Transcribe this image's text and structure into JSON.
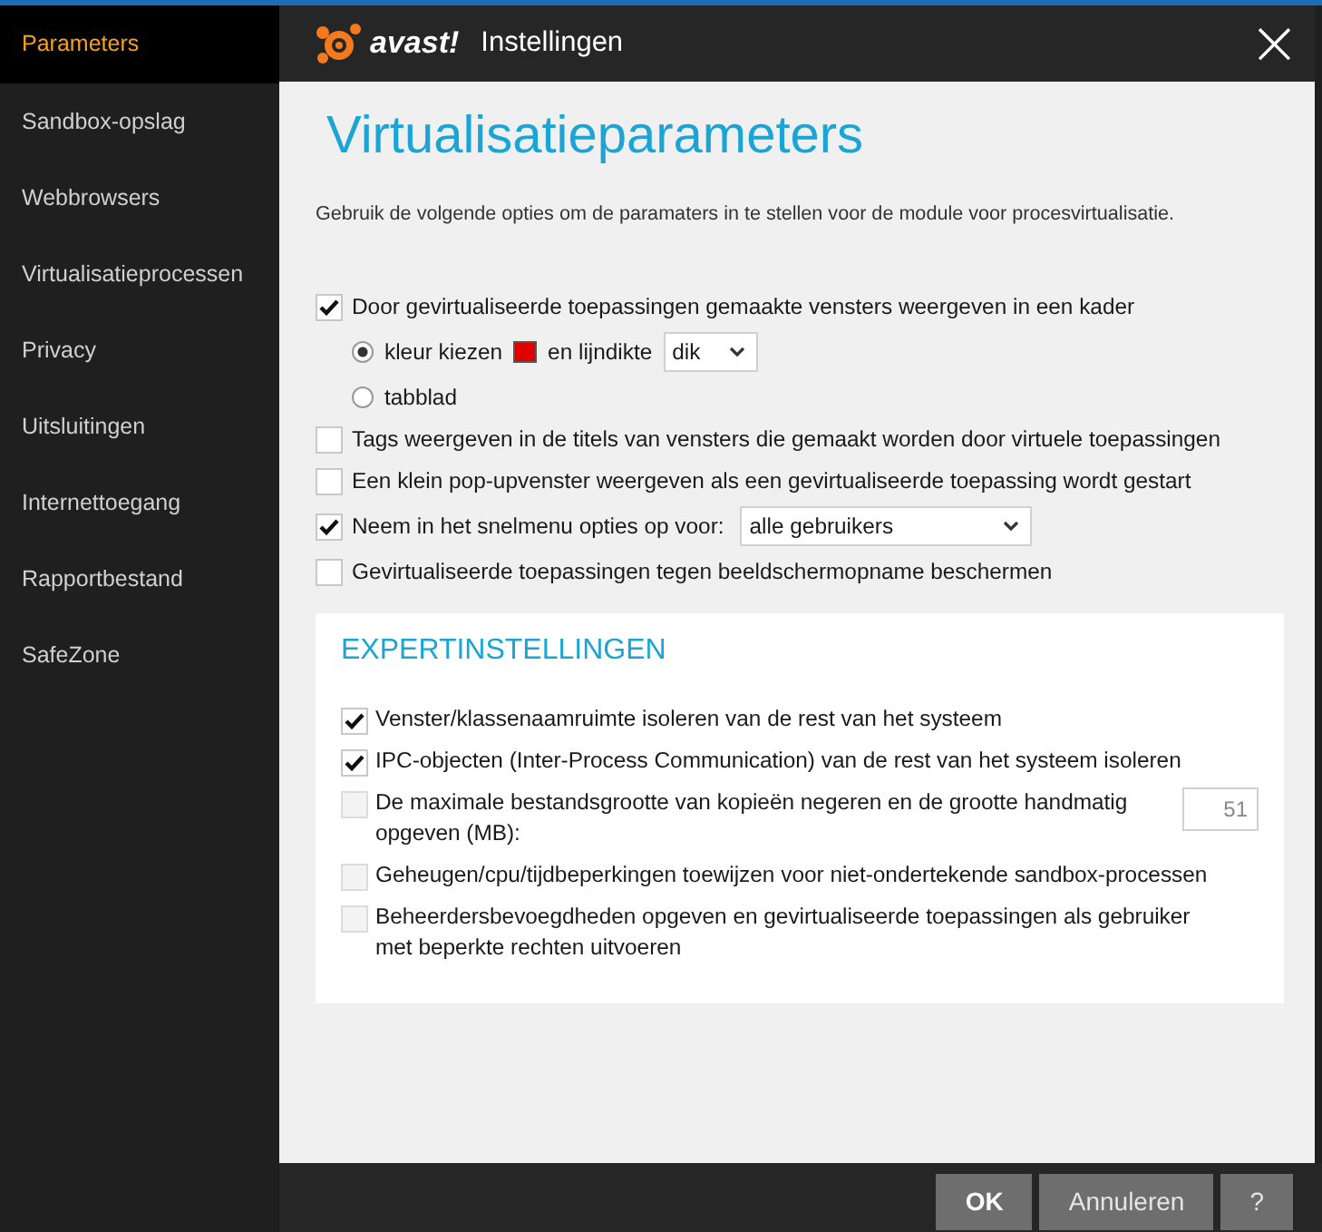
{
  "sidebar": {
    "items": [
      {
        "label": "Parameters",
        "selected": true
      },
      {
        "label": "Sandbox-opslag",
        "selected": false
      },
      {
        "label": "Webbrowsers",
        "selected": false
      },
      {
        "label": "Virtualisatieprocessen",
        "selected": false
      },
      {
        "label": "Privacy",
        "selected": false
      },
      {
        "label": "Uitsluitingen",
        "selected": false
      },
      {
        "label": "Internettoegang",
        "selected": false
      },
      {
        "label": "Rapportbestand",
        "selected": false
      },
      {
        "label": "SafeZone",
        "selected": false
      }
    ]
  },
  "header": {
    "logo": "avast!",
    "title": "Instellingen",
    "close": "×"
  },
  "page": {
    "title": "Virtualisatieparameters",
    "description": "Gebruik de volgende opties om de paramaters in te stellen voor de module voor procesvirtualisatie.",
    "options": [
      {
        "kind": "checkbox",
        "label": "Door gevirtualiseerde toepassingen gemaakte vensters weergeven in een kader",
        "checked": true
      },
      {
        "kind": "radio",
        "label": "kleur kiezen",
        "selected": true,
        "color": "#e00000",
        "suffix": "en lijndikte",
        "select": "dik"
      },
      {
        "kind": "radio",
        "label": "tabblad",
        "selected": false
      },
      {
        "kind": "checkbox",
        "label": "Tags weergeven in de titels van vensters die gemaakt worden door virtuele toepassingen",
        "checked": false
      },
      {
        "kind": "checkbox",
        "label": "Een klein pop-upvenster weergeven als een gevirtualiseerde toepassing wordt gestart",
        "checked": false
      },
      {
        "kind": "checkbox",
        "label": "Neem in het snelmenu opties op voor:",
        "checked": true,
        "select": "alle gebruikers"
      },
      {
        "kind": "checkbox",
        "label": "Gevirtualiseerde toepassingen tegen beeldschermopname beschermen",
        "checked": false
      }
    ]
  },
  "expert": {
    "title": "EXPERTINSTELLINGEN",
    "options": [
      {
        "label": "Venster/klassenaamruimte isoleren van de rest van het systeem",
        "checked": true
      },
      {
        "label": "IPC-objecten (Inter-Process Communication) van de rest van het systeem isoleren",
        "checked": true
      },
      {
        "label": "De maximale bestandsgrootte van kopieën negeren en de grootte handmatig opgeven (MB):",
        "checked": false,
        "value": "51"
      },
      {
        "label": "Geheugen/cpu/tijdbeperkingen toewijzen voor niet-ondertekende sandbox-processen",
        "checked": false
      },
      {
        "label": "Beheerdersbevoegdheden opgeven en gevirtualiseerde toepassingen als gebruiker met beperkte rechten uitvoeren",
        "checked": false
      }
    ]
  },
  "buttons": [
    {
      "label": "OK",
      "kind": "primary"
    },
    {
      "label": "Annuleren",
      "kind": "normal"
    },
    {
      "label": "?",
      "kind": "normal"
    }
  ]
}
